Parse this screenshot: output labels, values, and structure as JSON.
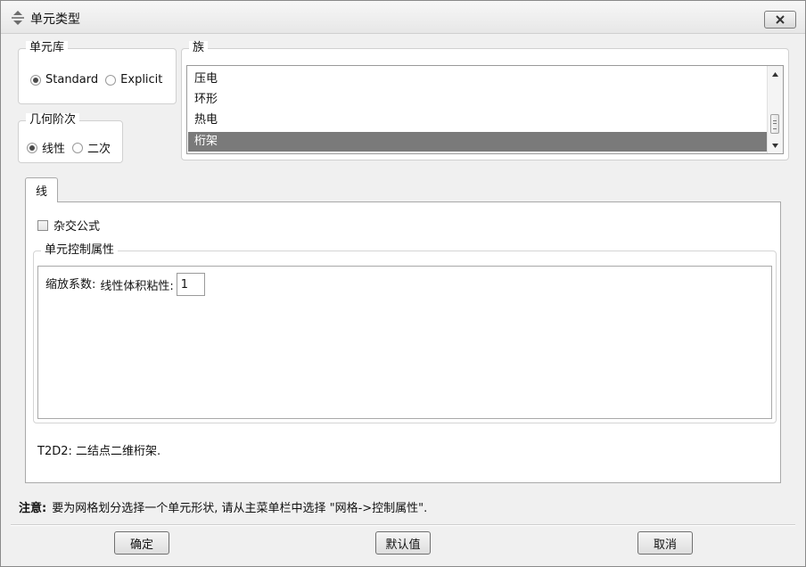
{
  "window": {
    "title": "单元类型",
    "icon": "element-type-icon",
    "close_icon": "close-icon"
  },
  "element_library": {
    "label": "单元库",
    "options": [
      {
        "label": "Standard",
        "checked": true
      },
      {
        "label": "Explicit",
        "checked": false
      }
    ]
  },
  "geometric_order": {
    "label": "几何阶次",
    "options": [
      {
        "label": "线性",
        "checked": true
      },
      {
        "label": "二次",
        "checked": false
      }
    ]
  },
  "family": {
    "label": "族",
    "items": [
      "压电",
      "环形",
      "热电",
      "桁架"
    ],
    "selected": "桁架"
  },
  "tab": {
    "label": "线"
  },
  "hybrid": {
    "label": "杂交公式",
    "checked": false
  },
  "element_controls": {
    "label": "单元控制属性",
    "scaling_label": "缩放系数:",
    "bulk_viscosity_label": "线性体积粘性:",
    "bulk_viscosity_value": "1"
  },
  "element_description": "T2D2:  二结点二维桁架.",
  "note": {
    "prefix": "注意:",
    "text": "要为网格划分选择一个单元形状, 请从主菜单栏中选择 \"网格->控制属性\"."
  },
  "buttons": {
    "ok": "确定",
    "defaults": "默认值",
    "cancel": "取消"
  },
  "colors": {
    "selection": "#7a7a7a",
    "dialog_bg": "#f0f0f0"
  }
}
